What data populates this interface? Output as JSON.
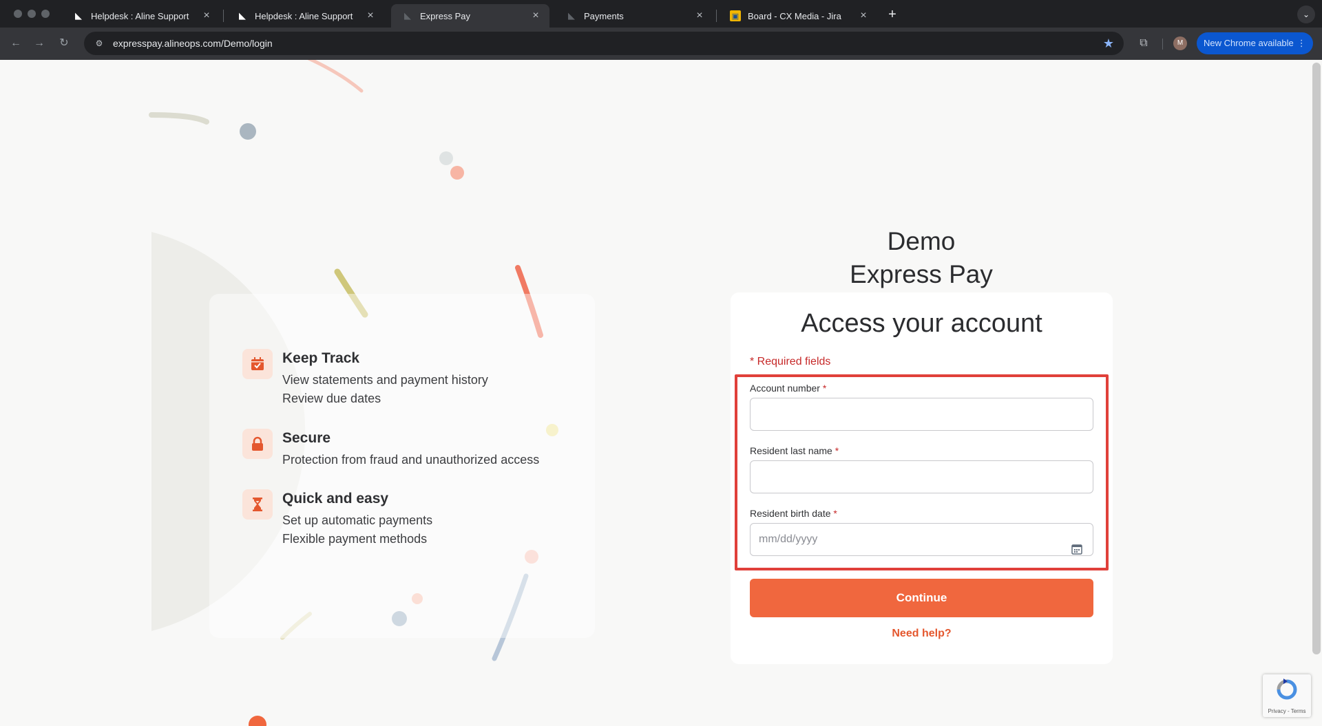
{
  "browser": {
    "tabs": [
      {
        "label": "Helpdesk : Aline Support",
        "favicon": "aline-logo-icon",
        "active": false
      },
      {
        "label": "Helpdesk : Aline Support",
        "favicon": "aline-logo-icon",
        "active": false
      },
      {
        "label": "Express Pay",
        "favicon": "aline-logo-icon",
        "active": true
      },
      {
        "label": "Payments",
        "favicon": "aline-logo-icon",
        "active": false
      },
      {
        "label": "Board - CX Media - Jira",
        "favicon": "jira-icon",
        "active": false
      }
    ],
    "url": "expresspay.alineops.com/Demo/login",
    "profile_initial": "M",
    "update_label": "New Chrome available"
  },
  "brand": {
    "line1": "Demo",
    "line2": "Express Pay"
  },
  "features": [
    {
      "icon": "calendar-check-icon",
      "title": "Keep Track",
      "lines": [
        "View statements and payment history",
        "Review due dates"
      ]
    },
    {
      "icon": "lock-icon",
      "title": "Secure",
      "lines": [
        "Protection from fraud and unauthorized access"
      ]
    },
    {
      "icon": "hourglass-icon",
      "title": "Quick and easy",
      "lines": [
        "Set up automatic payments",
        "Flexible payment methods"
      ]
    }
  ],
  "login": {
    "title": "Access your account",
    "required_note": "* Required fields",
    "account_label": "Account number",
    "lastname_label": "Resident last name",
    "birthdate_label": "Resident birth date",
    "required_mark": "*",
    "birthdate_placeholder": "mm/dd/yyyy",
    "continue_label": "Continue",
    "help_label": "Need help?"
  },
  "recaptcha": {
    "footer": "Privacy - Terms"
  },
  "colors": {
    "accent": "#f0673e",
    "required": "#c62828",
    "highlight": "#e0403a"
  }
}
